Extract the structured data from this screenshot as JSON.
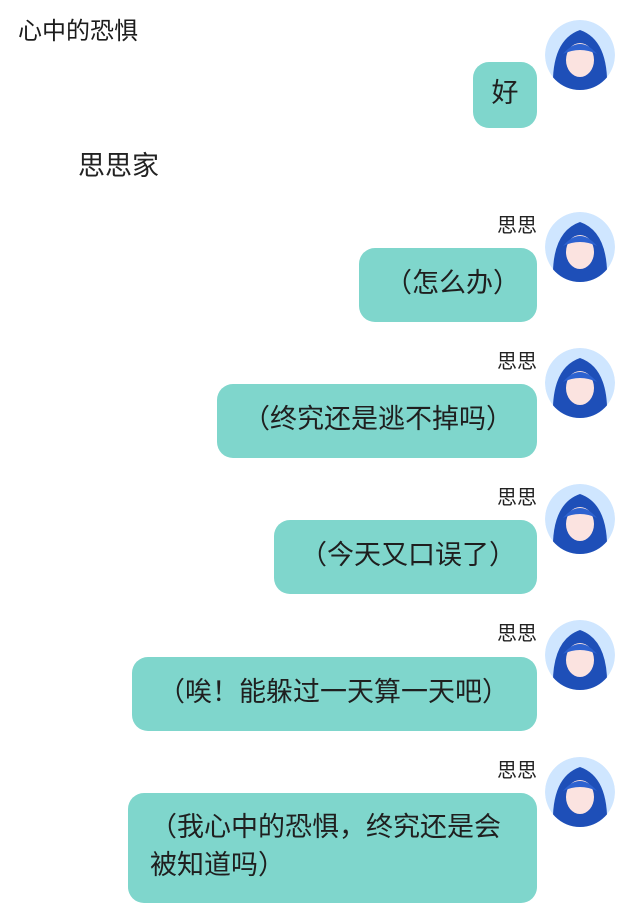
{
  "header": {
    "title": "心中的恐惧"
  },
  "top_message": {
    "text": "好"
  },
  "group": {
    "name": "思思家"
  },
  "messages": [
    {
      "sender": "思思",
      "text": "（怎么办）"
    },
    {
      "sender": "思思",
      "text": "（终究还是逃不掉吗）"
    },
    {
      "sender": "思思",
      "text": "（今天又口误了）"
    },
    {
      "sender": "思思",
      "text": "（唉！能躲过一天算一天吧）"
    },
    {
      "sender": "思思",
      "text": "（我心中的恐惧，终究还是会被知道吗）"
    }
  ],
  "colors": {
    "bubble": "#7fd6cc",
    "avatar_hair": "#1e4fb8",
    "avatar_bg": "#cfe6ff"
  }
}
